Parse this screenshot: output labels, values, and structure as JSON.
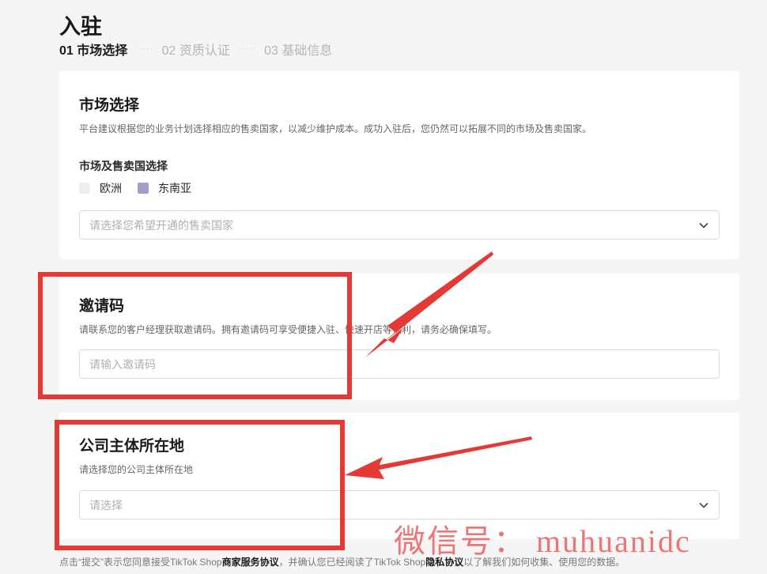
{
  "page": {
    "title": "入驻"
  },
  "steps": [
    {
      "label": "01 市场选择",
      "active": true
    },
    {
      "label": "02 资质认证",
      "active": false
    },
    {
      "label": "03 基础信息",
      "active": false
    }
  ],
  "step_separator": "·····",
  "market_section": {
    "title": "市场选择",
    "description": "平台建议根据您的业务计划选择相应的售卖国家，以减少维护成本。成功入驻后，您仍然可以拓展不同的市场及售卖国家。",
    "field_label": "市场及售卖国选择",
    "regions": [
      {
        "label": "欧洲",
        "checked": false
      },
      {
        "label": "东南亚",
        "checked": true
      }
    ],
    "country_select_placeholder": "请选择您希望开通的售卖国家"
  },
  "invite_section": {
    "title": "邀请码",
    "description": "请联系您的客户经理获取邀请码。拥有邀请码可享受便捷入驻、快速开店等福利，请务必确保填写。",
    "input_placeholder": "请输入邀请码"
  },
  "company_section": {
    "title": "公司主体所在地",
    "description": "请选择您的公司主体所在地",
    "select_placeholder": "请选择"
  },
  "footer": {
    "prefix": "点击“提交”表示您同意接受TikTok Shop",
    "link1": "商家服务协议",
    "middle": "，并确认您已经阅读了TikTok Shop",
    "link2": "隐私协议",
    "suffix": "以了解我们如何收集、使用您的数据。"
  },
  "watermark": "微信号： muhuanidc",
  "colors": {
    "annotation_red": "#e53935",
    "checkbox_checked": "#a59cc9"
  }
}
